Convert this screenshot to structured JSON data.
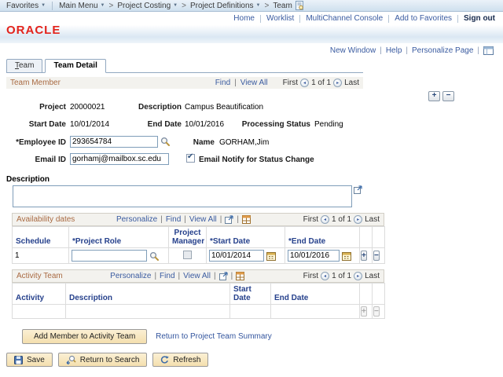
{
  "breadcrumb": {
    "favorites": "Favorites",
    "items": [
      "Main Menu",
      "Project Costing",
      "Project Definitions",
      "Team"
    ]
  },
  "header": {
    "logo": "ORACLE",
    "links": [
      "Home",
      "Worklist",
      "MultiChannel Console",
      "Add to Favorites"
    ],
    "sign_out": "Sign out"
  },
  "pagebar": {
    "new_window": "New Window",
    "help": "Help",
    "personalize_page": "Personalize Page"
  },
  "tabs": {
    "team": "Team",
    "team_detail": "Team Detail"
  },
  "pager": {
    "first": "First",
    "count": "1 of 1",
    "last": "Last"
  },
  "team_member": {
    "title": "Team Member",
    "find": "Find",
    "view_all": "View All",
    "project_label": "Project",
    "project_value": "20000021",
    "description_label": "Description",
    "description_value": "Campus Beautification",
    "start_date_label": "Start Date",
    "start_date_value": "10/01/2014",
    "end_date_label": "End Date",
    "end_date_value": "10/01/2016",
    "processing_status_label": "Processing Status",
    "processing_status_value": "Pending",
    "employee_id_label": "*Employee ID",
    "employee_id_value": "293654784",
    "name_label": "Name",
    "name_value": "GORHAM,Jim",
    "email_id_label": "Email ID",
    "email_id_value": "gorhamj@mailbox.sc.edu",
    "email_notify_label": "Email Notify for Status Change",
    "email_notify_checked": "true",
    "description_area_label": "Description",
    "description_area_value": ""
  },
  "availability": {
    "title": "Availability dates",
    "personalize": "Personalize",
    "find": "Find",
    "view_all": "View All",
    "columns": {
      "schedule": "Schedule",
      "project_role": "*Project Role",
      "project_manager": "Project Manager",
      "start_date": "*Start Date",
      "end_date": "*End Date"
    },
    "row": {
      "schedule": "1",
      "project_role": "",
      "project_manager_checked": "false",
      "start_date": "10/01/2014",
      "end_date": "10/01/2016"
    }
  },
  "activity_team": {
    "title": "Activity Team",
    "personalize": "Personalize",
    "find": "Find",
    "view_all": "View All",
    "columns": {
      "activity": "Activity",
      "description": "Description",
      "start_date": "Start Date",
      "end_date": "End Date"
    }
  },
  "actions": {
    "add_member": "Add Member to Activity Team",
    "return_link": "Return to Project Team Summary",
    "save": "Save",
    "return_to_search": "Return to Search",
    "refresh": "Refresh"
  },
  "icons": {
    "breadcrumb_caret": "dropdown-caret",
    "team_page": "page-icon",
    "personalize_layout": "layout-grid-icon",
    "lookup": "magnifier-icon",
    "calendar": "calendar-icon",
    "grid_popout": "popout-icon",
    "grid_download": "download-icon",
    "textarea_expand": "expand-icon",
    "save": "floppy-icon",
    "return_search": "search-return-icon",
    "refresh": "refresh-icon"
  },
  "colors": {
    "link": "#3a5ba0",
    "section_title": "#a96a42",
    "column_header": "#26418c",
    "logo_red": "#e3231c",
    "button_bg": "#f4dfae",
    "crumb_top": "#ebf2f9",
    "crumb_bottom": "#cfe0ee"
  }
}
